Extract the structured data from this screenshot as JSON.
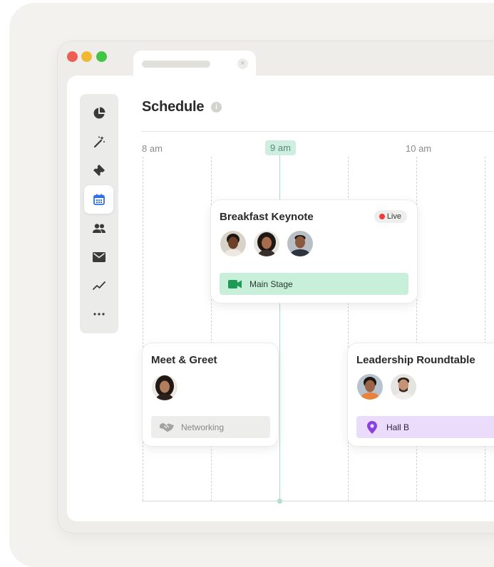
{
  "page": {
    "title": "Schedule"
  },
  "sidebar": {
    "items": [
      {
        "icon": "pie-chart-icon",
        "active": false
      },
      {
        "icon": "magic-wand-icon",
        "active": false
      },
      {
        "icon": "ticket-icon",
        "active": false
      },
      {
        "icon": "calendar-icon",
        "active": true
      },
      {
        "icon": "people-icon",
        "active": false
      },
      {
        "icon": "mail-icon",
        "active": false
      },
      {
        "icon": "trend-line-icon",
        "active": false
      },
      {
        "icon": "more-icon",
        "active": false
      }
    ]
  },
  "timeline": {
    "labels": [
      "8 am",
      "9 am",
      "10 am"
    ],
    "current": "9 am"
  },
  "events": [
    {
      "title": "Breakfast Keynote",
      "status": "Live",
      "location": "Main Stage",
      "location_icon": "video-camera-icon",
      "attendees": 3
    },
    {
      "title": "Meet & Greet",
      "location": "Networking",
      "location_icon": "handshake-icon",
      "attendees": 1
    },
    {
      "title": "Leadership Roundtable",
      "location": "Hall B",
      "location_icon": "map-pin-icon",
      "attendees": 2
    }
  ],
  "colors": {
    "accent_green": "#c8efd9",
    "live_dot": "#ef3b3b",
    "purple": "#ecdcfb",
    "calendar_blue": "#2f6fe8"
  }
}
